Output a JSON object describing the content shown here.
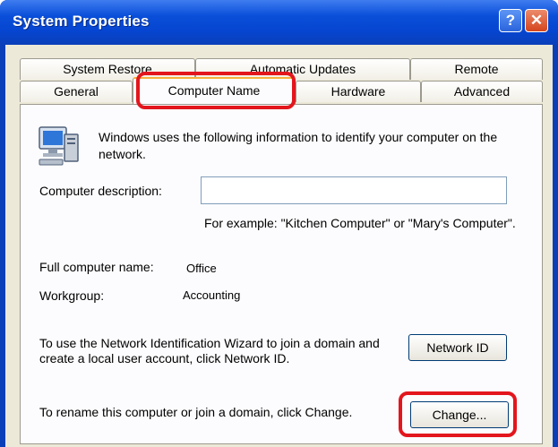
{
  "window": {
    "title": "System Properties",
    "help_glyph": "?",
    "close_glyph": "✕"
  },
  "tabs": {
    "row_back": [
      "System Restore",
      "Automatic Updates",
      "Remote"
    ],
    "row_front": [
      "General",
      "Computer Name",
      "Hardware",
      "Advanced"
    ],
    "active": "Computer Name"
  },
  "content": {
    "intro": "Windows uses the following information to identify your computer on the network.",
    "description_label": "Computer description:",
    "description_value": "",
    "example": "For example: \"Kitchen Computer\" or \"Mary's Computer\".",
    "full_name_label": "Full computer name:",
    "full_name_value": "Office",
    "workgroup_label": "Workgroup:",
    "workgroup_value": "Accounting",
    "network_id_text": "To use the Network Identification Wizard to join a domain and create a local user account, click Network ID.",
    "network_id_button": "Network ID",
    "change_text": "To rename this computer or join a domain, click Change.",
    "change_button": "Change..."
  },
  "colors": {
    "titlebar": "#0645d0",
    "highlight": "#e3161d",
    "dialog_bg": "#ece9d8"
  }
}
